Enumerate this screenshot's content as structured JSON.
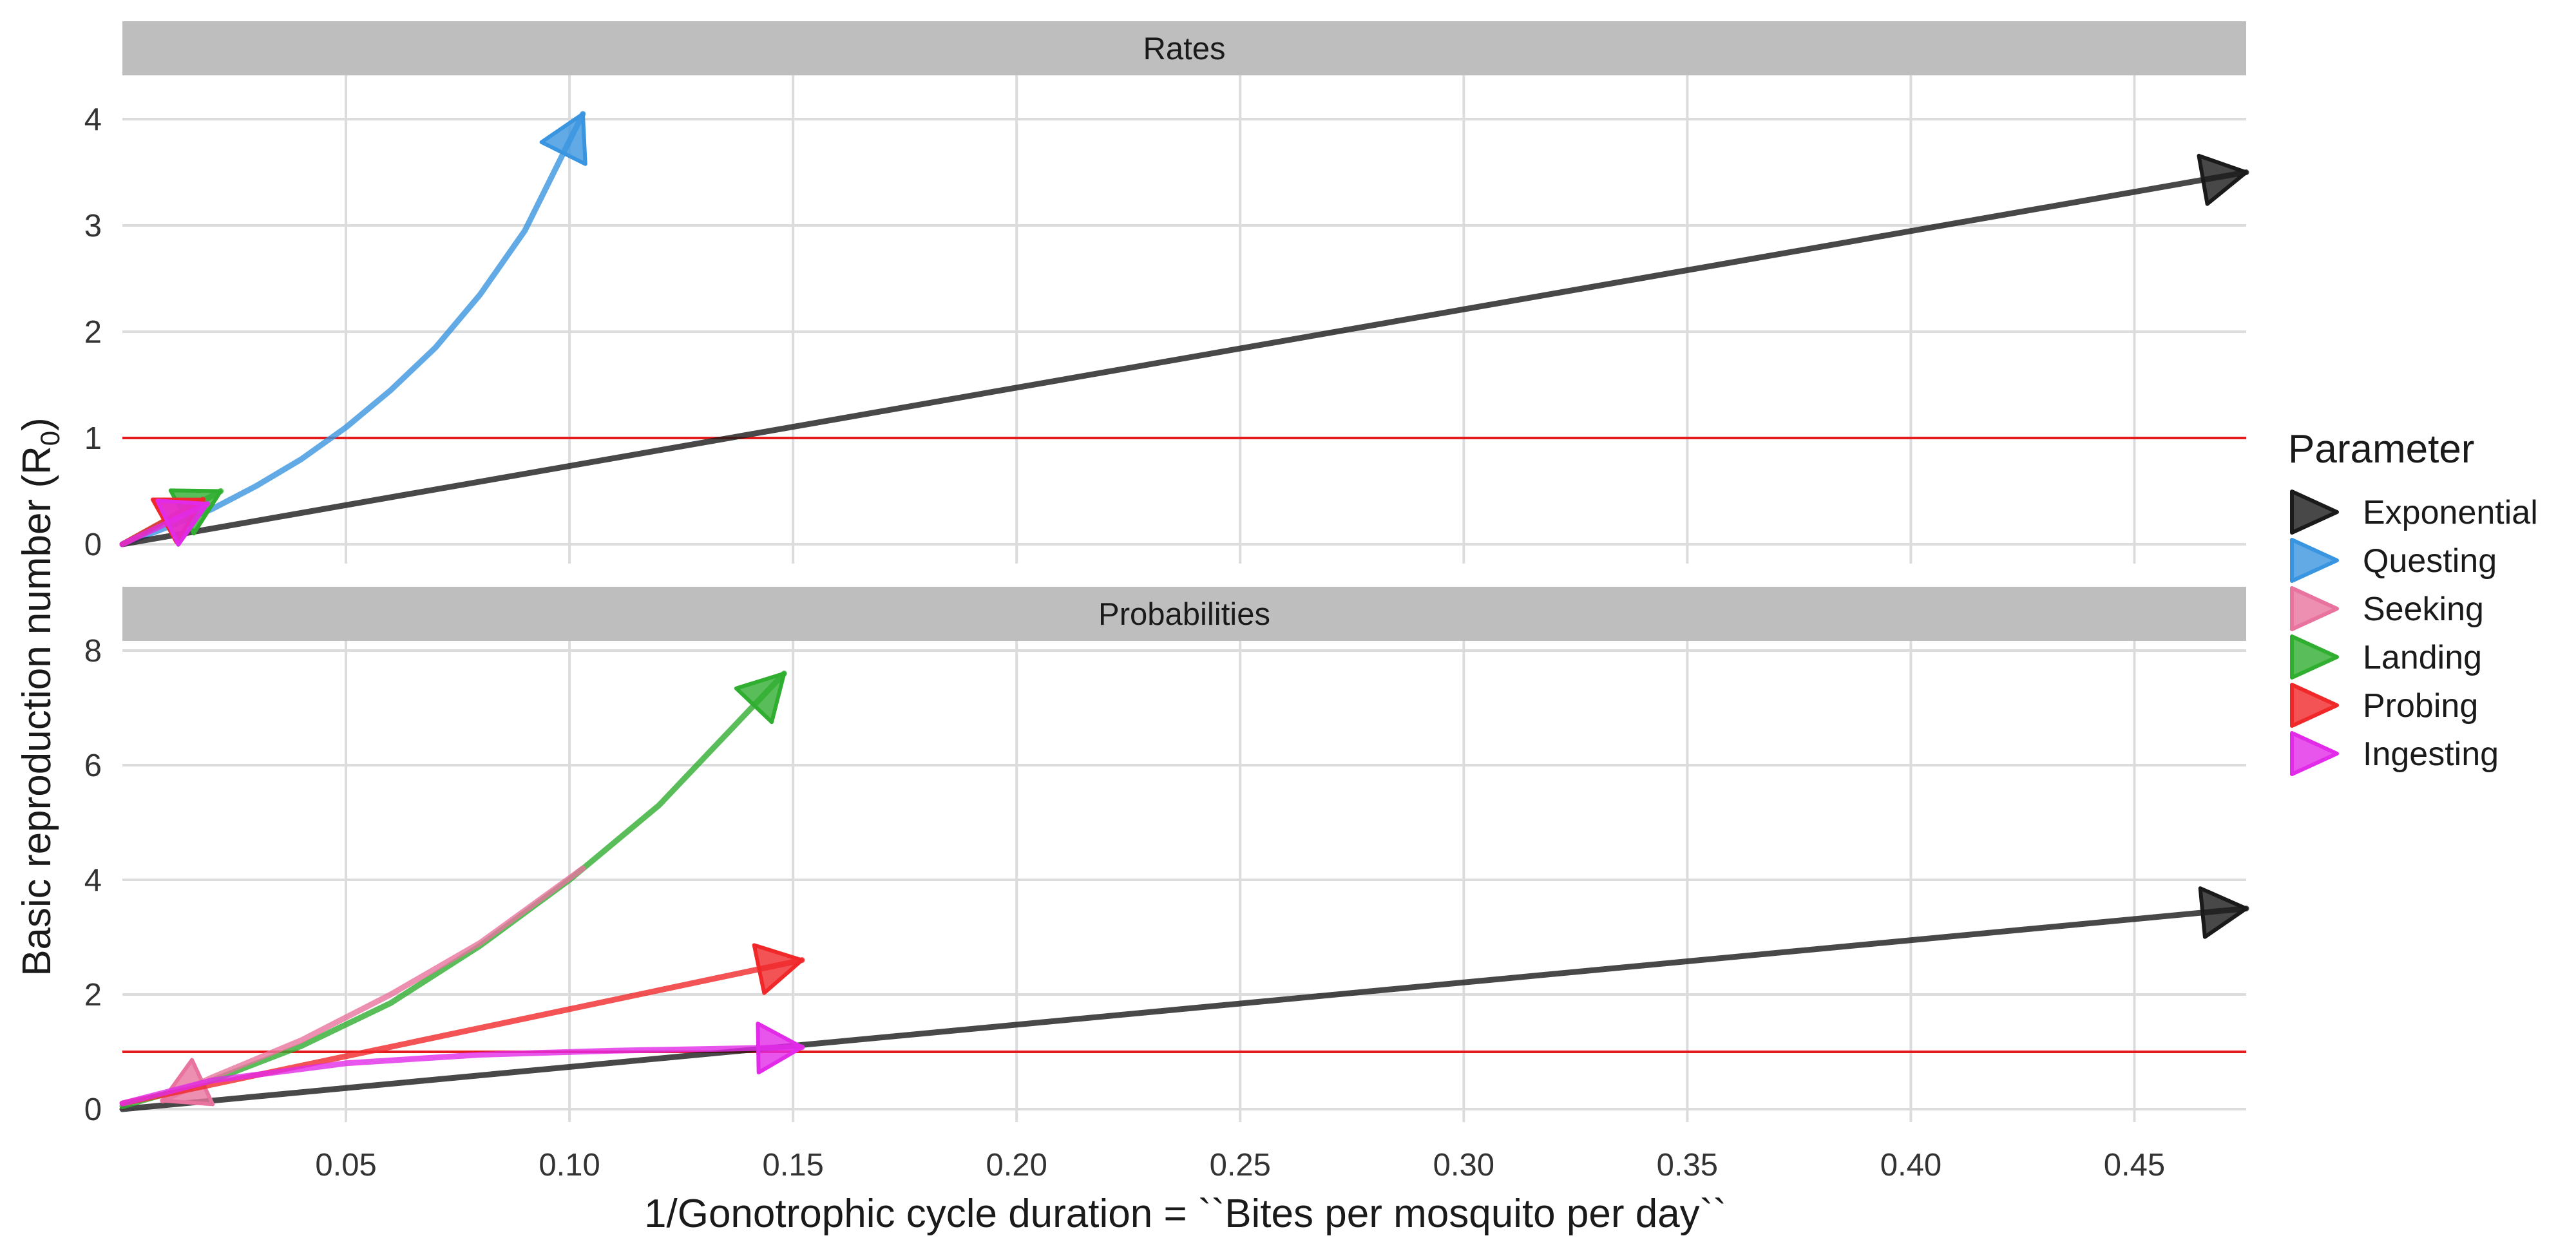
{
  "chart_data": {
    "type": "line",
    "xlabel": "1/Gonotrophic cycle duration = ``Bites per mosquito per day``",
    "ylabel_main": "Basic reproduction number (R",
    "ylabel_sub": "0",
    "ylabel_close": ")",
    "xlim": [
      0,
      0.475
    ],
    "x_ticks": [
      "0.05",
      "0.10",
      "0.15",
      "0.20",
      "0.25",
      "0.30",
      "0.35",
      "0.40",
      "0.45"
    ],
    "x_tick_values": [
      0.05,
      0.1,
      0.15,
      0.2,
      0.25,
      0.3,
      0.35,
      0.4,
      0.45
    ],
    "grid": true,
    "legend": {
      "title": "Parameter",
      "position": "right",
      "entries": [
        {
          "label": "Exponential",
          "color": "#1a1a1a"
        },
        {
          "label": "Questing",
          "color": "#3a95e0"
        },
        {
          "label": "Seeking",
          "color": "#e8739e"
        },
        {
          "label": "Landing",
          "color": "#2fae2f"
        },
        {
          "label": "Probing",
          "color": "#f0282a"
        },
        {
          "label": "Ingesting",
          "color": "#e22be8"
        }
      ]
    },
    "threshold": {
      "y": 1,
      "color": "#e41a1c"
    },
    "panels": [
      {
        "title": "Rates",
        "ylim": [
          0,
          4.4
        ],
        "y_ticks": [
          "0",
          "1",
          "2",
          "3",
          "4"
        ],
        "y_tick_values": [
          0,
          1,
          2,
          3,
          4
        ],
        "series": [
          {
            "name": "Questing",
            "x": [
              0.0,
              0.01,
              0.02,
              0.03,
              0.04,
              0.05,
              0.06,
              0.07,
              0.08,
              0.09,
              0.103
            ],
            "y": [
              0.0,
              0.16,
              0.33,
              0.55,
              0.8,
              1.1,
              1.45,
              1.85,
              2.35,
              2.95,
              4.05
            ]
          },
          {
            "name": "Exponential",
            "x": [
              0.0,
              0.475
            ],
            "y": [
              0.0,
              3.5
            ]
          },
          {
            "name": "Landing",
            "x": [
              0.0,
              0.022
            ],
            "y": [
              0.0,
              0.5
            ]
          },
          {
            "name": "Probing",
            "x": [
              0.0,
              0.018
            ],
            "y": [
              0.0,
              0.42
            ]
          },
          {
            "name": "Ingesting",
            "x": [
              0.0,
              0.019
            ],
            "y": [
              0.0,
              0.38
            ]
          }
        ]
      },
      {
        "title": "Probabilities",
        "ylim": [
          0,
          8.2
        ],
        "y_ticks": [
          "0",
          "2",
          "4",
          "6",
          "8"
        ],
        "y_tick_values": [
          0,
          2,
          4,
          6,
          8
        ],
        "series": [
          {
            "name": "Exponential",
            "x": [
              0.0,
              0.475
            ],
            "y": [
              0.0,
              3.5
            ]
          },
          {
            "name": "Landing",
            "x": [
              0.0,
              0.02,
              0.04,
              0.06,
              0.08,
              0.1,
              0.12,
              0.148
            ],
            "y": [
              0.05,
              0.5,
              1.1,
              1.85,
              2.85,
              4.0,
              5.3,
              7.6
            ]
          },
          {
            "name": "Seeking",
            "x": [
              0.103,
              0.08,
              0.06,
              0.04,
              0.02,
              0.009
            ],
            "y": [
              4.2,
              2.9,
              2.0,
              1.2,
              0.55,
              0.15
            ]
          },
          {
            "name": "Probing",
            "x": [
              0.0,
              0.152
            ],
            "y": [
              0.1,
              2.6
            ]
          },
          {
            "name": "Ingesting",
            "x": [
              0.0,
              0.02,
              0.05,
              0.08,
              0.11,
              0.152
            ],
            "y": [
              0.1,
              0.5,
              0.8,
              0.95,
              1.02,
              1.08
            ]
          }
        ]
      }
    ]
  }
}
